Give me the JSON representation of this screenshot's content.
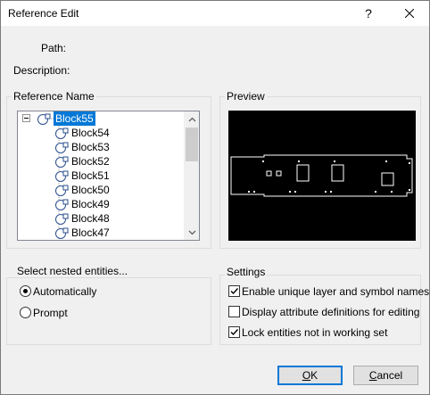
{
  "window": {
    "title": "Reference Edit",
    "help_glyph": "?",
    "close_glyph": "✕"
  },
  "fields": {
    "path_label": "Path:",
    "description_label": "Description:"
  },
  "reference_name": {
    "group_title": "Reference Name",
    "items": [
      "Block55",
      "Block54",
      "Block53",
      "Block52",
      "Block51",
      "Block50",
      "Block49",
      "Block48",
      "Block47"
    ],
    "selected": "Block55"
  },
  "preview": {
    "group_title": "Preview"
  },
  "nested": {
    "group_title": "Select nested entities...",
    "options": [
      {
        "label": "Automatically",
        "checked": true
      },
      {
        "label": "Prompt",
        "checked": false
      }
    ]
  },
  "settings": {
    "group_title": "Settings",
    "options": [
      {
        "label": "Enable unique layer and symbol names",
        "checked": true
      },
      {
        "label": "Display attribute definitions for editing",
        "checked": false
      },
      {
        "label": "Lock entities not in working set",
        "checked": true
      }
    ]
  },
  "buttons": {
    "ok_first": "O",
    "ok_rest": "K",
    "cancel_first": "C",
    "cancel_rest": "ancel"
  },
  "colors": {
    "selection": "#0078d7",
    "preview_bg": "#000000",
    "accent": "#0078d7"
  }
}
